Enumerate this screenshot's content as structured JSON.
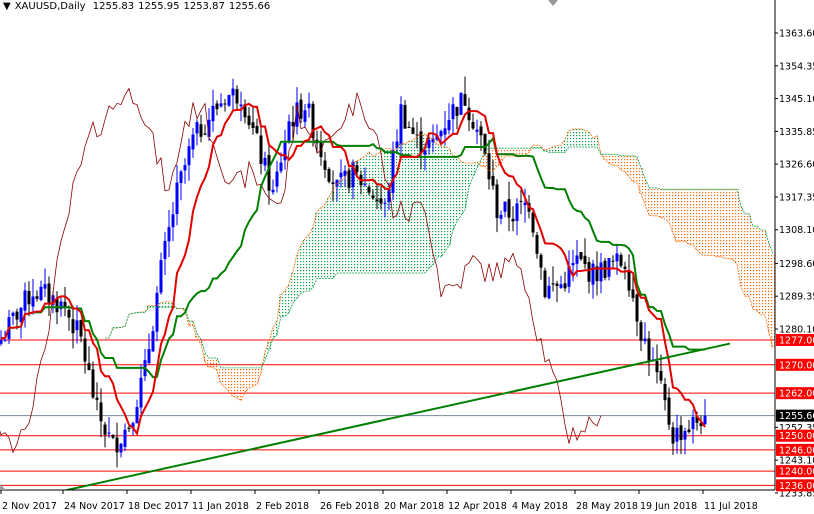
{
  "header": {
    "symbol": "XAUUSD,Daily",
    "open": "1255.83",
    "high": "1255.95",
    "low": "1253.87",
    "close": "1255.66"
  },
  "chart_data": {
    "type": "candlestick",
    "title": "XAUUSD,Daily",
    "indicator": "Ichimoku Kinko Hyo",
    "ylim": [
      1233.85,
      1363.6
    ],
    "y_ticks": [
      "1363.60",
      "1354.35",
      "1345.10",
      "1335.85",
      "1326.60",
      "1317.35",
      "1308.10",
      "1298.60",
      "1289.35",
      "1280.10",
      "1252.35",
      "1243.10",
      "1233.85"
    ],
    "x_ticks": [
      "2 Nov 2017",
      "24 Nov 2017",
      "18 Dec 2017",
      "11 Jan 2018",
      "2 Feb 2018",
      "26 Feb 2018",
      "20 Mar 2018",
      "12 Apr 2018",
      "4 May 2018",
      "28 May 2018",
      "19 Jun 2018",
      "11 Jul 2018"
    ],
    "close_path_every_4_bars": [
      1277.0,
      1284.6,
      1290.8,
      1289.4,
      1286.0,
      1277.0,
      1256.7,
      1247.1,
      1253.3,
      1268.3,
      1296.7,
      1318.5,
      1333.4,
      1339.9,
      1345.8,
      1346.7,
      1332.3,
      1317.9,
      1338.5,
      1343.6,
      1330.6,
      1319.6,
      1324.1,
      1319.6,
      1314.0,
      1341.9,
      1332.9,
      1331.8,
      1340.8,
      1345.3,
      1333.4,
      1313.7,
      1312.5,
      1315.9,
      1291.4,
      1292.5,
      1299.3,
      1295.6,
      1297.9,
      1299.3,
      1279.8,
      1266.3,
      1250.2,
      1252.5,
      1255.9
    ],
    "levels": [
      {
        "label": "1277.00",
        "value": 1277.0
      },
      {
        "label": "1270.00",
        "value": 1270.0
      },
      {
        "label": "1262.00",
        "value": 1262.0
      },
      {
        "label": "1250.00",
        "value": 1250.0
      },
      {
        "label": "1246.00",
        "value": 1246.0
      },
      {
        "label": "1240.00",
        "value": 1240.0
      },
      {
        "label": "1236.00",
        "value": 1236.0
      }
    ],
    "current_price": {
      "label": "1255.66",
      "value": 1255.66
    },
    "trendline": {
      "from_price": 1233.0,
      "to_price": 1276.0,
      "color": "#006400"
    },
    "colors": {
      "bull": "#0000ff",
      "bear": "#000000",
      "tenkan": "#e00000",
      "kijun": "#008000",
      "chikou": "#8b0000",
      "cloud_bear": "#ff6600",
      "cloud_bull": "#00a040",
      "level": "#ff0000"
    }
  }
}
